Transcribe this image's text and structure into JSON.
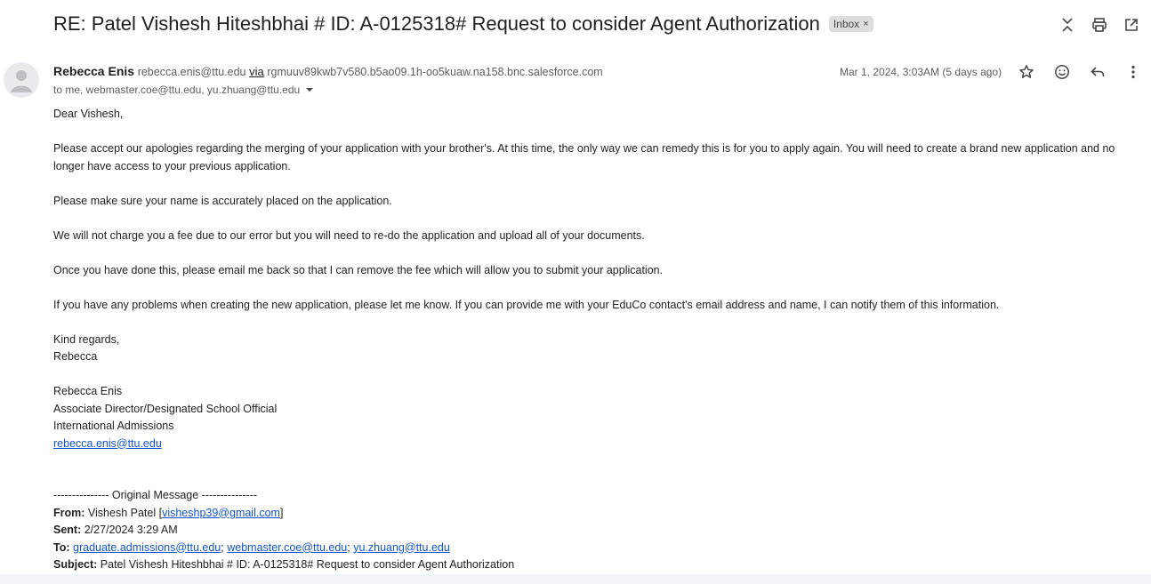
{
  "header": {
    "subject": "RE: Patel Vishesh Hiteshbhai # ID: A-0125318# Request to consider Agent Authorization",
    "label": "Inbox",
    "label_close": "×"
  },
  "sender": {
    "name": "Rebecca Enis",
    "email": "rebecca.enis@ttu.edu",
    "via_text": "via",
    "via_domain": "rgmuuv89kwb7v580.b5ao09.1h-oo5kuaw.na158.bnc.salesforce.com",
    "recipients": "to me, webmaster.coe@ttu.edu, yu.zhuang@ttu.edu",
    "date": "Mar 1, 2024, 3:03AM (5 days ago)"
  },
  "body": {
    "greeting": "Dear Vishesh,",
    "p1": "Please accept our apologies regarding the merging of your application with your brother's.  At this time, the only way we can remedy this is for you to apply again. You will need to create a brand new application and no longer have access to your previous application.",
    "p2": "Please make sure your name is accurately placed on the application.",
    "p3": "We will not charge you a fee due to our error but you will need to re-do the application and upload all of your documents.",
    "p4": "Once you have done this, please email me back so that I can remove the fee which will allow you to submit your application.",
    "p5": "If you have any problems when creating the new application, please let me know. If you can provide me with your EduCo contact's email address and name, I can notify them of this information.",
    "closing": "Kind regards,",
    "closing_name": "Rebecca",
    "sig_name": "Rebecca Enis",
    "sig_title": "Associate Director/Designated School Official",
    "sig_dept": "International Admissions",
    "sig_email": "rebecca.enis@ttu.edu"
  },
  "original": {
    "divider": "--------------- Original Message ---------------",
    "from_label": "From:",
    "from_name": "Vishesh Patel [",
    "from_email": "visheshp39@gmail.com",
    "from_close": "]",
    "sent_label": "Sent:",
    "sent_value": "2/27/2024 3:29 AM",
    "to_label": "To:",
    "to_1": "graduate.admissions@ttu.edu",
    "to_2": "webmaster.coe@ttu.edu",
    "to_3": "yu.zhuang@ttu.edu",
    "sep": ";",
    "subject_label": "Subject:",
    "subject_value": "Patel Vishesh Hiteshbhai # ID: A-0125318# Request to consider Agent Authorization"
  }
}
